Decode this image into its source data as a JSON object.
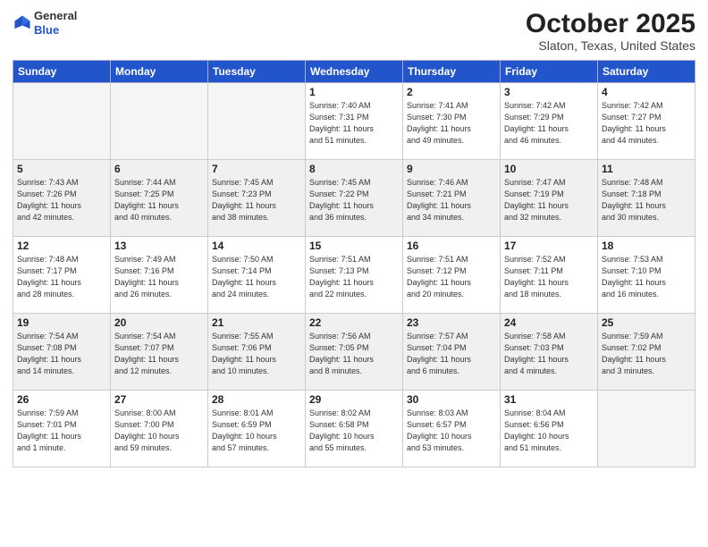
{
  "header": {
    "logo_line1": "General",
    "logo_line2": "Blue",
    "month": "October 2025",
    "location": "Slaton, Texas, United States"
  },
  "days_of_week": [
    "Sunday",
    "Monday",
    "Tuesday",
    "Wednesday",
    "Thursday",
    "Friday",
    "Saturday"
  ],
  "weeks": [
    {
      "shade": false,
      "days": [
        {
          "num": "",
          "info": ""
        },
        {
          "num": "",
          "info": ""
        },
        {
          "num": "",
          "info": ""
        },
        {
          "num": "1",
          "info": "Sunrise: 7:40 AM\nSunset: 7:31 PM\nDaylight: 11 hours\nand 51 minutes."
        },
        {
          "num": "2",
          "info": "Sunrise: 7:41 AM\nSunset: 7:30 PM\nDaylight: 11 hours\nand 49 minutes."
        },
        {
          "num": "3",
          "info": "Sunrise: 7:42 AM\nSunset: 7:29 PM\nDaylight: 11 hours\nand 46 minutes."
        },
        {
          "num": "4",
          "info": "Sunrise: 7:42 AM\nSunset: 7:27 PM\nDaylight: 11 hours\nand 44 minutes."
        }
      ]
    },
    {
      "shade": true,
      "days": [
        {
          "num": "5",
          "info": "Sunrise: 7:43 AM\nSunset: 7:26 PM\nDaylight: 11 hours\nand 42 minutes."
        },
        {
          "num": "6",
          "info": "Sunrise: 7:44 AM\nSunset: 7:25 PM\nDaylight: 11 hours\nand 40 minutes."
        },
        {
          "num": "7",
          "info": "Sunrise: 7:45 AM\nSunset: 7:23 PM\nDaylight: 11 hours\nand 38 minutes."
        },
        {
          "num": "8",
          "info": "Sunrise: 7:45 AM\nSunset: 7:22 PM\nDaylight: 11 hours\nand 36 minutes."
        },
        {
          "num": "9",
          "info": "Sunrise: 7:46 AM\nSunset: 7:21 PM\nDaylight: 11 hours\nand 34 minutes."
        },
        {
          "num": "10",
          "info": "Sunrise: 7:47 AM\nSunset: 7:19 PM\nDaylight: 11 hours\nand 32 minutes."
        },
        {
          "num": "11",
          "info": "Sunrise: 7:48 AM\nSunset: 7:18 PM\nDaylight: 11 hours\nand 30 minutes."
        }
      ]
    },
    {
      "shade": false,
      "days": [
        {
          "num": "12",
          "info": "Sunrise: 7:48 AM\nSunset: 7:17 PM\nDaylight: 11 hours\nand 28 minutes."
        },
        {
          "num": "13",
          "info": "Sunrise: 7:49 AM\nSunset: 7:16 PM\nDaylight: 11 hours\nand 26 minutes."
        },
        {
          "num": "14",
          "info": "Sunrise: 7:50 AM\nSunset: 7:14 PM\nDaylight: 11 hours\nand 24 minutes."
        },
        {
          "num": "15",
          "info": "Sunrise: 7:51 AM\nSunset: 7:13 PM\nDaylight: 11 hours\nand 22 minutes."
        },
        {
          "num": "16",
          "info": "Sunrise: 7:51 AM\nSunset: 7:12 PM\nDaylight: 11 hours\nand 20 minutes."
        },
        {
          "num": "17",
          "info": "Sunrise: 7:52 AM\nSunset: 7:11 PM\nDaylight: 11 hours\nand 18 minutes."
        },
        {
          "num": "18",
          "info": "Sunrise: 7:53 AM\nSunset: 7:10 PM\nDaylight: 11 hours\nand 16 minutes."
        }
      ]
    },
    {
      "shade": true,
      "days": [
        {
          "num": "19",
          "info": "Sunrise: 7:54 AM\nSunset: 7:08 PM\nDaylight: 11 hours\nand 14 minutes."
        },
        {
          "num": "20",
          "info": "Sunrise: 7:54 AM\nSunset: 7:07 PM\nDaylight: 11 hours\nand 12 minutes."
        },
        {
          "num": "21",
          "info": "Sunrise: 7:55 AM\nSunset: 7:06 PM\nDaylight: 11 hours\nand 10 minutes."
        },
        {
          "num": "22",
          "info": "Sunrise: 7:56 AM\nSunset: 7:05 PM\nDaylight: 11 hours\nand 8 minutes."
        },
        {
          "num": "23",
          "info": "Sunrise: 7:57 AM\nSunset: 7:04 PM\nDaylight: 11 hours\nand 6 minutes."
        },
        {
          "num": "24",
          "info": "Sunrise: 7:58 AM\nSunset: 7:03 PM\nDaylight: 11 hours\nand 4 minutes."
        },
        {
          "num": "25",
          "info": "Sunrise: 7:59 AM\nSunset: 7:02 PM\nDaylight: 11 hours\nand 3 minutes."
        }
      ]
    },
    {
      "shade": false,
      "days": [
        {
          "num": "26",
          "info": "Sunrise: 7:59 AM\nSunset: 7:01 PM\nDaylight: 11 hours\nand 1 minute."
        },
        {
          "num": "27",
          "info": "Sunrise: 8:00 AM\nSunset: 7:00 PM\nDaylight: 10 hours\nand 59 minutes."
        },
        {
          "num": "28",
          "info": "Sunrise: 8:01 AM\nSunset: 6:59 PM\nDaylight: 10 hours\nand 57 minutes."
        },
        {
          "num": "29",
          "info": "Sunrise: 8:02 AM\nSunset: 6:58 PM\nDaylight: 10 hours\nand 55 minutes."
        },
        {
          "num": "30",
          "info": "Sunrise: 8:03 AM\nSunset: 6:57 PM\nDaylight: 10 hours\nand 53 minutes."
        },
        {
          "num": "31",
          "info": "Sunrise: 8:04 AM\nSunset: 6:56 PM\nDaylight: 10 hours\nand 51 minutes."
        },
        {
          "num": "",
          "info": ""
        }
      ]
    }
  ]
}
